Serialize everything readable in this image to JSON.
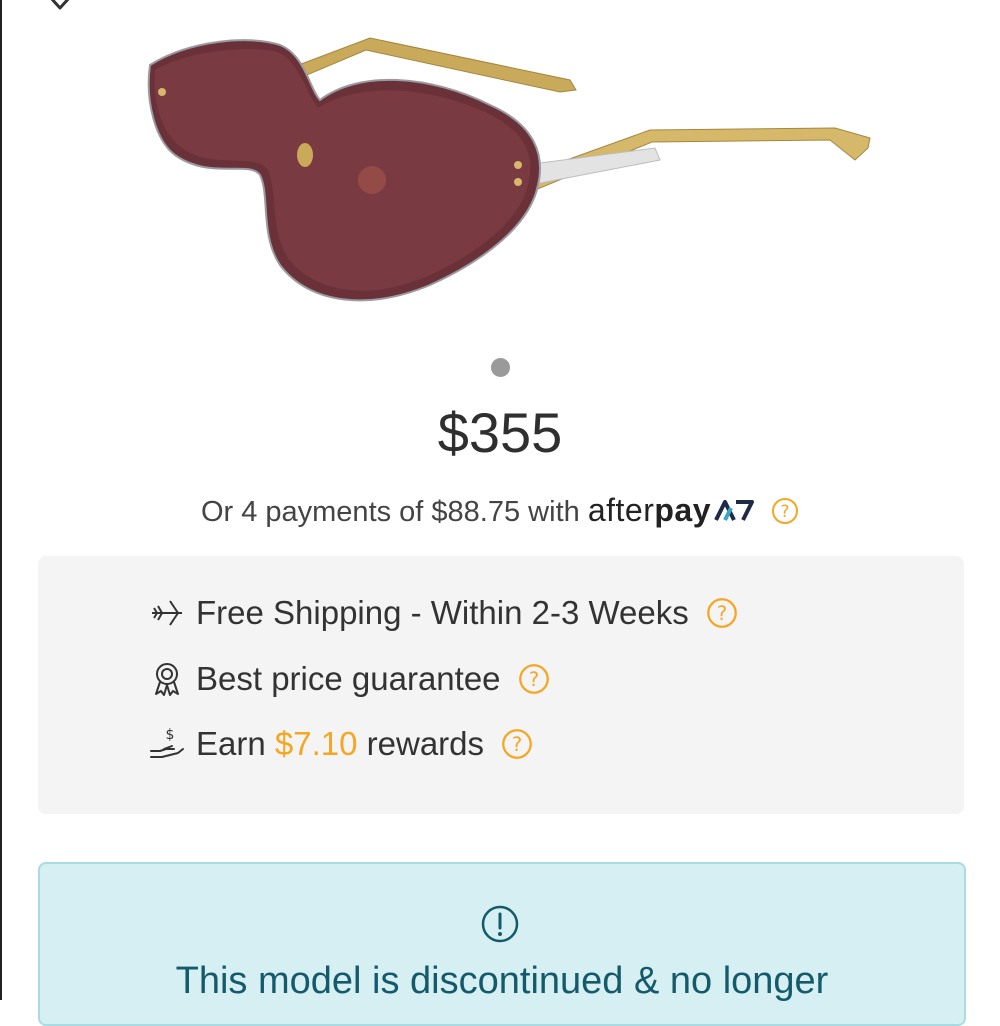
{
  "colors": {
    "accent": "#f5a623",
    "text": "#333333",
    "notice_bg": "#d5eff2",
    "notice_text": "#155a6a",
    "box_bg": "#f4f4f4"
  },
  "product": {
    "image_alt": "Sunglasses with burgundy shield lens and gold temples",
    "carousel": {
      "page": 1,
      "total": 1
    },
    "price": "$355"
  },
  "afterpay": {
    "prefix": "Or 4 payments of $88.75 with",
    "logo_light": "after",
    "logo_bold": "pay",
    "help_icon": "question-circle-icon"
  },
  "perks": [
    {
      "icon": "plane-icon",
      "text": "Free Shipping - Within 2-3 Weeks"
    },
    {
      "icon": "award-ribbon-icon",
      "text": "Best price guarantee"
    },
    {
      "icon": "hand-dollar-icon",
      "text_before": "Earn",
      "amount": "$7.10",
      "text_after": "rewards"
    }
  ],
  "notice": {
    "icon": "exclamation-circle-icon",
    "text": "This model is discontinued & no longer"
  },
  "header": {
    "favorite_icon": "heart-icon"
  }
}
